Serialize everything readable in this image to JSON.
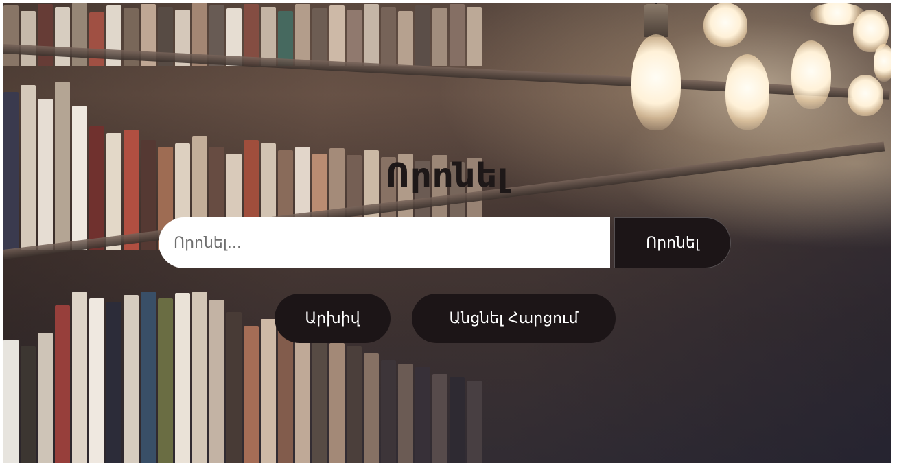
{
  "page": {
    "title": "Որոնել"
  },
  "search": {
    "placeholder": "Որոնել...",
    "value": "",
    "button_label": "Որոնել"
  },
  "actions": {
    "archive_label": "Արխիվ",
    "quiz_label": "Անցնել Հարցում"
  },
  "colors": {
    "button_bg": "#1c1517",
    "button_text": "#ffffff",
    "title_text": "#1e1818",
    "input_bg": "#ffffff"
  },
  "background": {
    "icon": "library-bookshelf-background"
  }
}
